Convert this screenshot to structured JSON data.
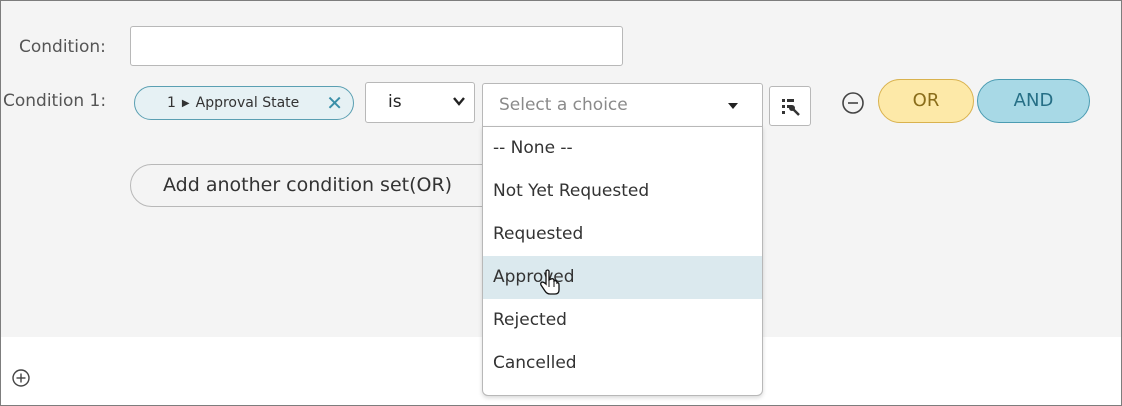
{
  "labels": {
    "condition": "Condition:",
    "condition_1": "Condition 1:"
  },
  "condition_input": {
    "value": ""
  },
  "field_pill": {
    "number": "1",
    "field": "Approval State"
  },
  "operator": {
    "value": "is"
  },
  "choice": {
    "placeholder": "Select a choice",
    "options": [
      {
        "label": "-- None --",
        "highlighted": false
      },
      {
        "label": "Not Yet Requested",
        "highlighted": false
      },
      {
        "label": "Requested",
        "highlighted": false
      },
      {
        "label": "Approved",
        "highlighted": true
      },
      {
        "label": "Rejected",
        "highlighted": false
      },
      {
        "label": "Cancelled",
        "highlighted": false
      }
    ]
  },
  "buttons": {
    "or": "OR",
    "and": "AND",
    "add_condition_set": "Add another condition set(OR)"
  },
  "icons": {
    "pill_separator": "caret-right-icon",
    "pill_remove": "close-icon",
    "operator_dropdown": "chevron-down-icon",
    "choice_dropdown": "caret-down-icon",
    "reference": "reference-lookup-icon",
    "remove_condition": "minus-circle-icon",
    "add": "plus-circle-icon",
    "cursor": "hand-pointer-icon"
  },
  "colors": {
    "or_bg": "#fde9a8",
    "and_bg": "#a8d9e6",
    "pill_border": "#5a9fb2",
    "highlight": "#dbe9ee"
  }
}
